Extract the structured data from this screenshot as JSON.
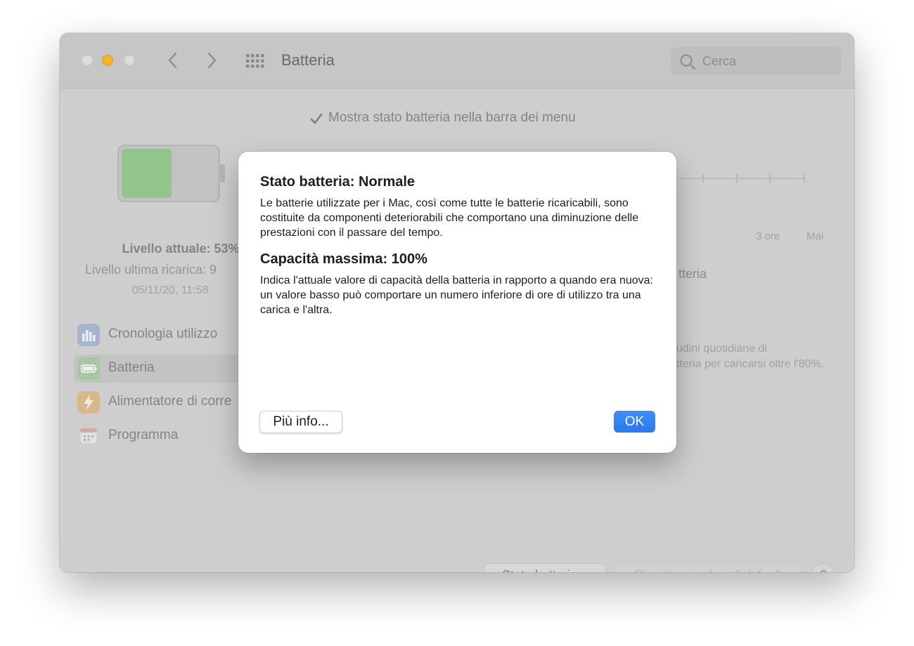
{
  "window": {
    "title": "Batteria",
    "search_placeholder": "Cerca"
  },
  "background": {
    "menu_checkbox_label": "Mostra stato batteria nella barra dei menu",
    "menu_checkbox_checked": true,
    "charge_level_fraction": 0.53,
    "level_current": "Livello attuale: 53%",
    "level_last_charge": "Livello ultima ricarica: 9",
    "level_date": "05/11/20, 11:58",
    "slider_labels": [
      "3 ore",
      "Mai"
    ],
    "right_fragment_1": "tteria",
    "right_fragment_2": "udini quotidiane di",
    "right_fragment_3": "tteria per caricarsi oltre l'80%.",
    "sidebar": [
      {
        "label": "Cronologia utilizzo",
        "icon": "chart-icon",
        "selected": false
      },
      {
        "label": "Batteria",
        "icon": "battery-icon",
        "selected": true
      },
      {
        "label": "Alimentatore di corre",
        "icon": "bolt-icon",
        "selected": false
      },
      {
        "label": "Programma",
        "icon": "calendar-icon",
        "selected": false
      }
    ],
    "btn_stato": "Stato batteria...",
    "btn_ripristina": "Ripristina i valori di default",
    "btn_help": "?"
  },
  "dialog": {
    "heading1": "Stato batteria: Normale",
    "paragraph1": "Le batterie utilizzate per i Mac, così come tutte le batterie ricaricabili, sono costituite da componenti deteriorabili che comportano una diminuzione delle prestazioni con il passare del tempo.",
    "heading2": "Capacità massima: 100%",
    "paragraph2": "Indica l'attuale valore di capacità della batteria in rapporto a quando era nuova: un valore basso può comportare un numero inferiore di ore di utilizzo tra una carica e l'altra.",
    "btn_info": "Più info...",
    "btn_ok": "OK"
  },
  "colors": {
    "accent": "#2f80f3",
    "traffic_minimize": "#f1b527",
    "battery_fill": "#93c48b"
  }
}
